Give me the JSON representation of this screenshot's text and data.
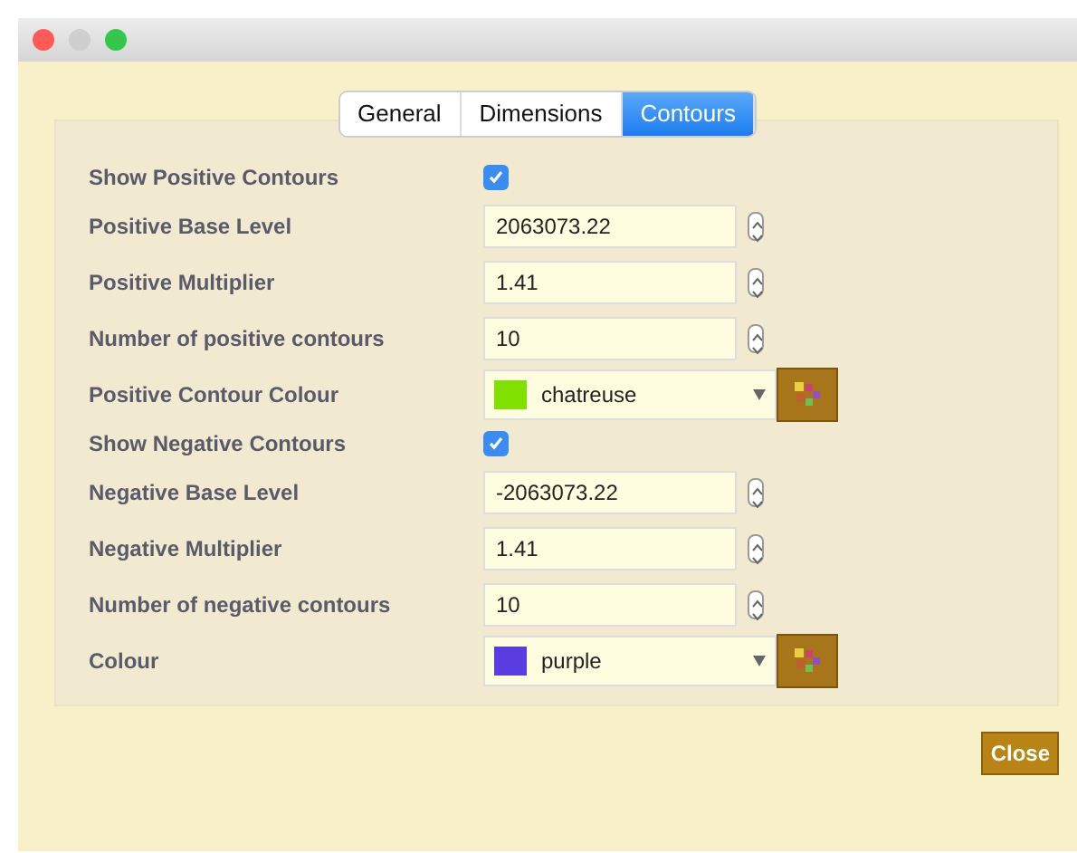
{
  "tabs": [
    {
      "label": "General",
      "selected": false
    },
    {
      "label": "Dimensions",
      "selected": false
    },
    {
      "label": "Contours",
      "selected": true
    }
  ],
  "rows": [
    {
      "kind": "checkbox",
      "label": "Show Positive Contours",
      "checked": true
    },
    {
      "kind": "spin",
      "label": "Positive Base Level",
      "value": "2063073.22"
    },
    {
      "kind": "spin",
      "label": "Positive Multiplier",
      "value": "1.41"
    },
    {
      "kind": "spin",
      "label": "Number of positive contours",
      "value": "10"
    },
    {
      "kind": "color",
      "label": "Positive Contour Colour",
      "value": "chatreuse",
      "color": "#80e000"
    },
    {
      "kind": "checkbox",
      "label": "Show Negative Contours",
      "checked": true
    },
    {
      "kind": "spin",
      "label": "Negative Base Level",
      "value": "-2063073.22"
    },
    {
      "kind": "spin",
      "label": "Negative Multiplier",
      "value": "1.41"
    },
    {
      "kind": "spin",
      "label": "Number of negative contours",
      "value": "10"
    },
    {
      "kind": "color",
      "label": "Colour",
      "value": "purple",
      "color": "#5a3de0"
    }
  ],
  "close_button": "Close"
}
